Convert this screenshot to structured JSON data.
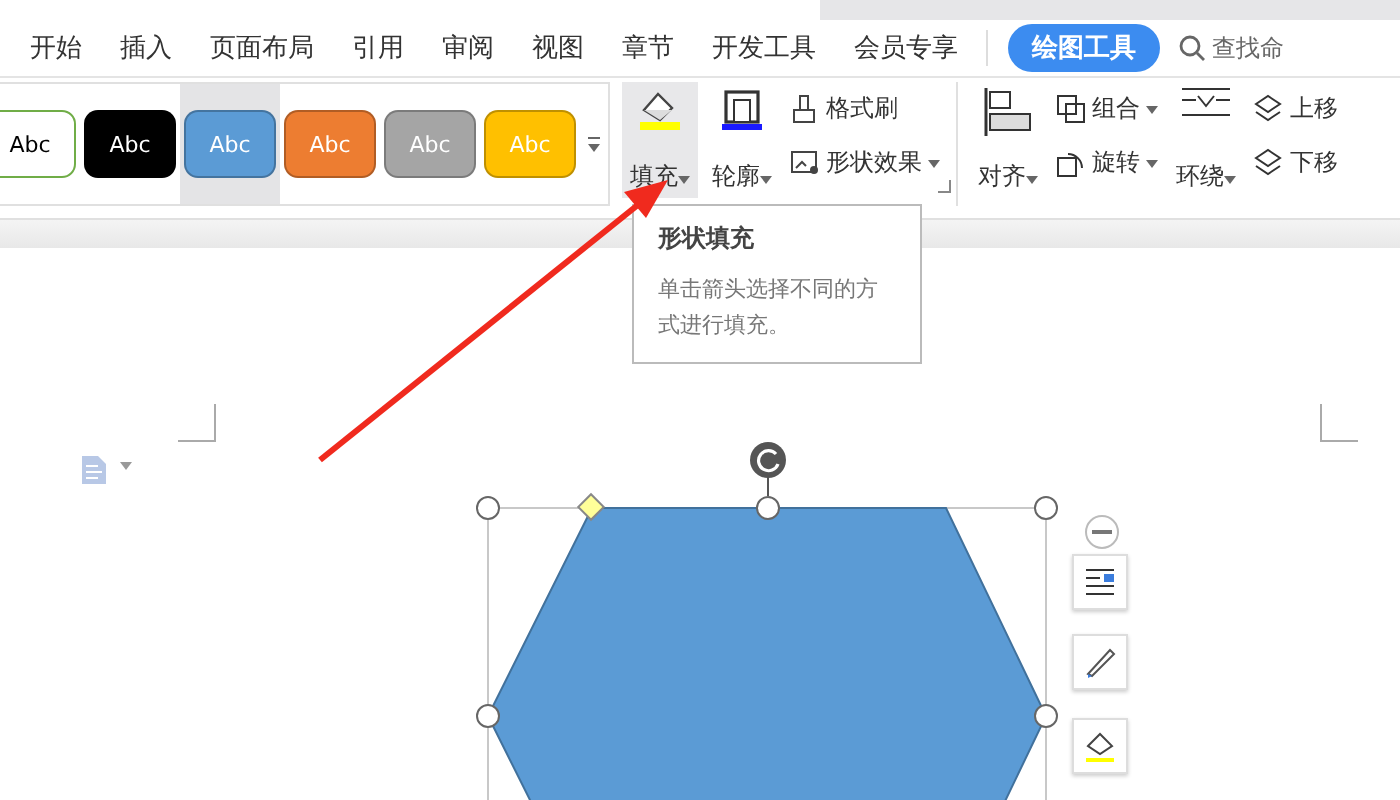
{
  "tabs": [
    {
      "label": "开始",
      "selected": false
    },
    {
      "label": "插入",
      "selected": false
    },
    {
      "label": "页面布局",
      "selected": false
    },
    {
      "label": "引用",
      "selected": false
    },
    {
      "label": "审阅",
      "selected": false
    },
    {
      "label": "视图",
      "selected": false
    },
    {
      "label": "章节",
      "selected": false
    },
    {
      "label": "开发工具",
      "selected": false
    },
    {
      "label": "会员专享",
      "selected": false
    },
    {
      "label": "绘图工具",
      "selected": true
    }
  ],
  "search": {
    "placeholder": "查找命"
  },
  "style_gallery": [
    {
      "label": "Abc",
      "color": "#ffffff",
      "selected": false
    },
    {
      "label": "Abc",
      "color": "#000000",
      "selected": false
    },
    {
      "label": "Abc",
      "color": "#5b9bd5",
      "selected": true
    },
    {
      "label": "Abc",
      "color": "#ed7d31",
      "selected": false
    },
    {
      "label": "Abc",
      "color": "#a5a5a5",
      "selected": false
    },
    {
      "label": "Abc",
      "color": "#ffc000",
      "selected": false
    }
  ],
  "shape_tools": [
    {
      "kind": "large",
      "label": "填充",
      "dropdown": true,
      "highlighted": true
    },
    {
      "kind": "large",
      "label": "轮廓",
      "dropdown": true,
      "highlighted": false
    },
    {
      "kind": "small",
      "label": "格式刷",
      "dropdown": false,
      "highlighted": false
    },
    {
      "kind": "small",
      "label": "形状效果",
      "dropdown": true,
      "highlighted": false
    }
  ],
  "arrange_tools": [
    {
      "kind": "large",
      "label": "对齐",
      "dropdown": true
    },
    {
      "kind": "small",
      "label": "组合",
      "dropdown": true
    },
    {
      "kind": "small",
      "label": "旋转",
      "dropdown": true
    },
    {
      "kind": "large",
      "label": "环绕",
      "dropdown": true
    },
    {
      "kind": "small",
      "label": "上移",
      "dropdown": false
    },
    {
      "kind": "small",
      "label": "下移",
      "dropdown": false
    }
  ],
  "tooltip": {
    "title": "形状填充",
    "body": "单击箭头选择不同的方式进行填充。"
  }
}
